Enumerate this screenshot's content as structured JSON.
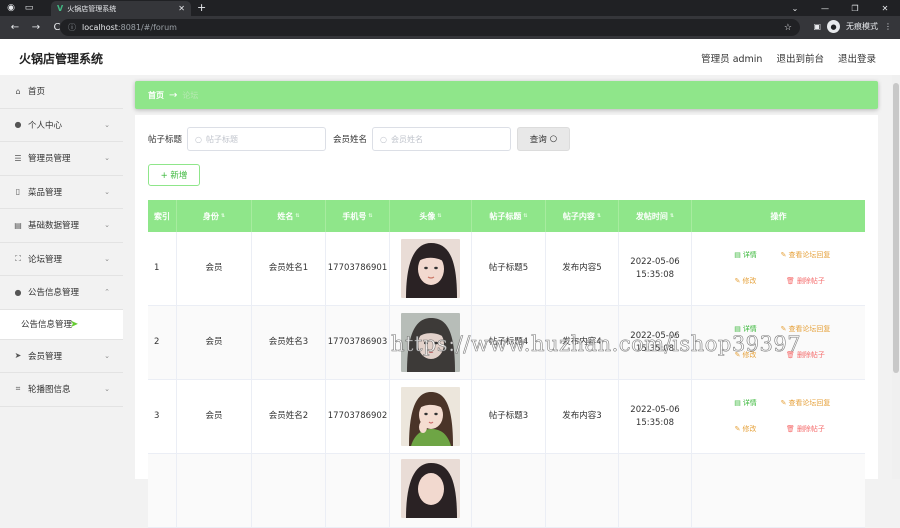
{
  "browser": {
    "tab_title": "火锅店管理系统",
    "tab_close": "✕",
    "new_tab": "+",
    "url_host": "localhost",
    "url_path": ":8081/#/forum",
    "incognito_label": "无痕模式",
    "nav_back": "←",
    "nav_forward": "→",
    "nav_reload": "C"
  },
  "header": {
    "title": "火锅店管理系统",
    "user": "管理员 admin",
    "to_frontend": "退出到前台",
    "logout": "退出登录"
  },
  "sidebar": {
    "items": [
      {
        "label": "首页",
        "icon": "home-icon"
      },
      {
        "label": "个人中心",
        "icon": "user-icon"
      },
      {
        "label": "管理员管理",
        "icon": "list-icon"
      },
      {
        "label": "菜品管理",
        "icon": "dish-icon"
      },
      {
        "label": "基础数据管理",
        "icon": "data-icon"
      },
      {
        "label": "论坛管理",
        "icon": "forum-icon"
      },
      {
        "label": "公告信息管理",
        "icon": "user-icon"
      },
      {
        "label": "会员管理",
        "icon": "send-icon"
      },
      {
        "label": "轮播图信息",
        "icon": "crop-icon"
      }
    ],
    "sub_item": "公告信息管理"
  },
  "breadcrumb": {
    "home": "首页",
    "arrow": "→",
    "current": "论坛"
  },
  "search": {
    "title_label": "帖子标题",
    "title_placeholder": "帖子标题",
    "name_label": "会员姓名",
    "name_placeholder": "会员姓名",
    "query_button": "查询",
    "add_button": "+ 新增"
  },
  "table": {
    "columns": [
      "索引",
      "身份",
      "姓名",
      "手机号",
      "头像",
      "帖子标题",
      "帖子内容",
      "发帖时间",
      "操作"
    ],
    "rows": [
      {
        "index": "1",
        "role": "会员",
        "name": "会员姓名1",
        "phone": "17703786901",
        "title": "帖子标题5",
        "content": "发布内容5",
        "time": "2022-05-06 15:35:08"
      },
      {
        "index": "2",
        "role": "会员",
        "name": "会员姓名3",
        "phone": "17703786903",
        "title": "帖子标题4",
        "content": "发布内容4",
        "time": "2022-05-06 15:35:08"
      },
      {
        "index": "3",
        "role": "会员",
        "name": "会员姓名2",
        "phone": "17703786902",
        "title": "帖子标题3",
        "content": "发布内容3",
        "time": "2022-05-06 15:35:08"
      }
    ],
    "actions": {
      "detail": "详情",
      "view_replies": "查看论坛回复",
      "edit": "修改",
      "delete": "删除帖子"
    }
  },
  "watermark": "https://www.huzhan.com/ishop39397",
  "colors": {
    "accent_green": "#8fe68a",
    "edit_orange": "#e6a23c",
    "delete_red": "#f56c6c"
  }
}
